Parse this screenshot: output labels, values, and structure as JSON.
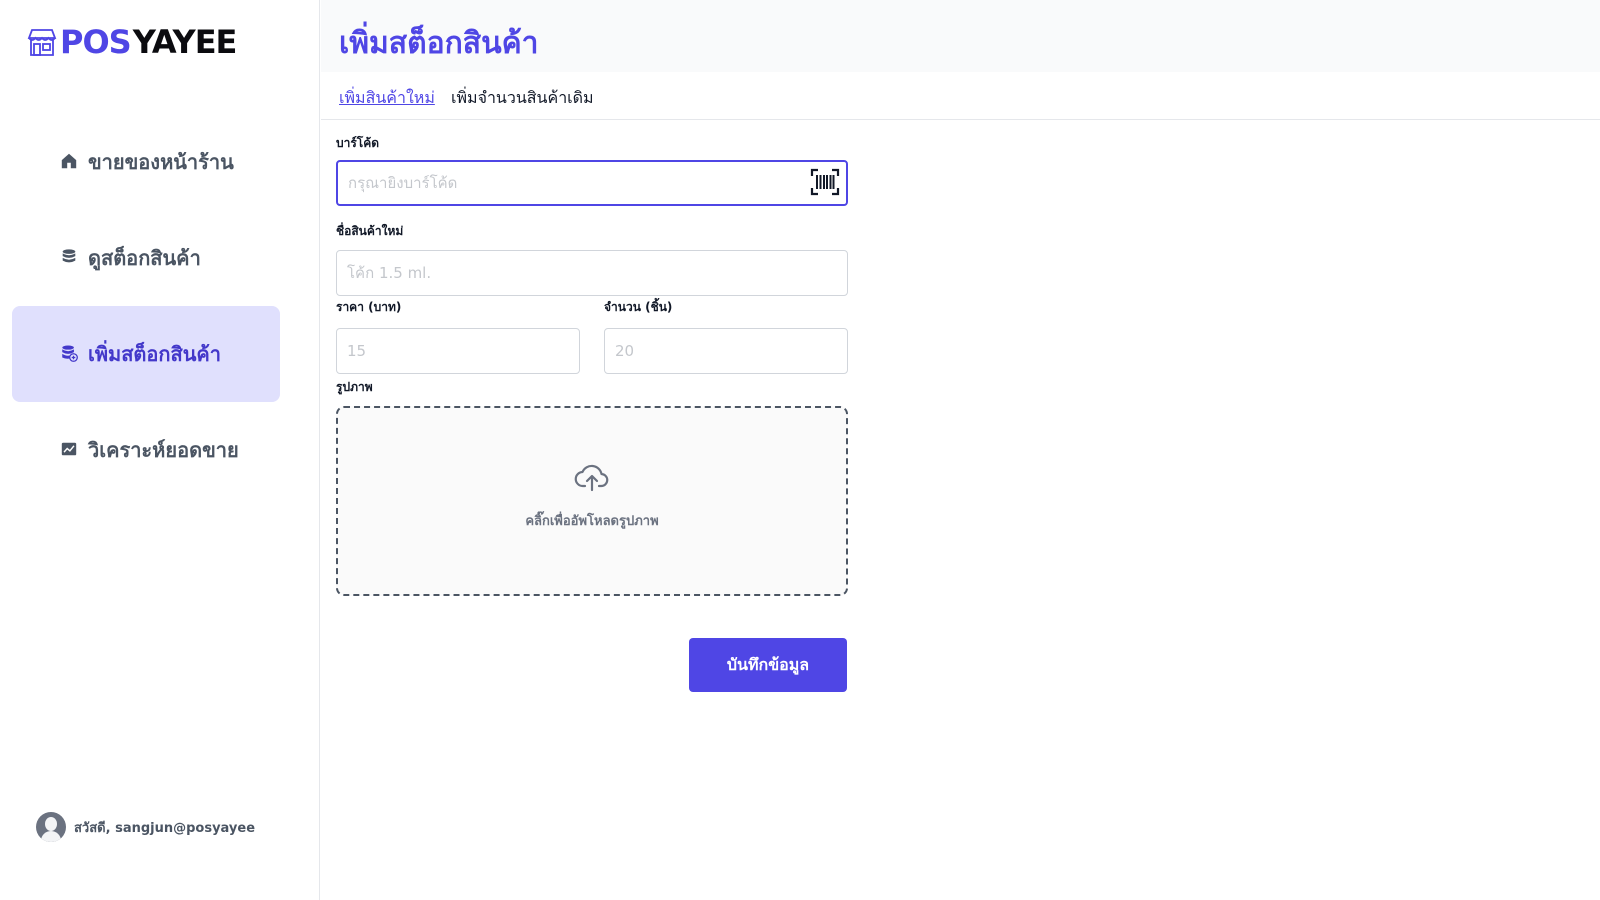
{
  "brand": {
    "part1": "POS",
    "part2": "YAYEE",
    "accent": "#4f46e5"
  },
  "sidebar": {
    "items": [
      {
        "label": "ขายของหน้าร้าน",
        "icon": "home-icon"
      },
      {
        "label": "ดูสต็อกสินค้า",
        "icon": "database-icon"
      },
      {
        "label": "เพิ่มสต็อกสินค้า",
        "icon": "database-add-icon",
        "active": true
      },
      {
        "label": "วิเคราะห์ยอดขาย",
        "icon": "chart-icon"
      }
    ],
    "user": "สวัสดี, sangjun@posyayee"
  },
  "header": {
    "title": "เพิ่มสต็อกสินค้า"
  },
  "tabs": [
    {
      "label": "เพิ่มสินค้าใหม่",
      "active": true
    },
    {
      "label": "เพิ่มจำนวนสินค้าเดิม",
      "active": false
    }
  ],
  "form": {
    "barcode": {
      "label": "บาร์โค้ด",
      "placeholder": "กรุณายิงบาร์โค้ด"
    },
    "name": {
      "label": "ชื่อสินค้าใหม่",
      "placeholder": "โค้ก 1.5 ml."
    },
    "price": {
      "label": "ราคา (บาท)",
      "placeholder": "15"
    },
    "quantity": {
      "label": "จำนวน (ชิ้น)",
      "placeholder": "20"
    },
    "image": {
      "label": "รูปภาพ",
      "upload_text": "คลิ๊กเพื่ออัพโหลดรูปภาพ"
    },
    "save_label": "บันทึกข้อมูล"
  }
}
